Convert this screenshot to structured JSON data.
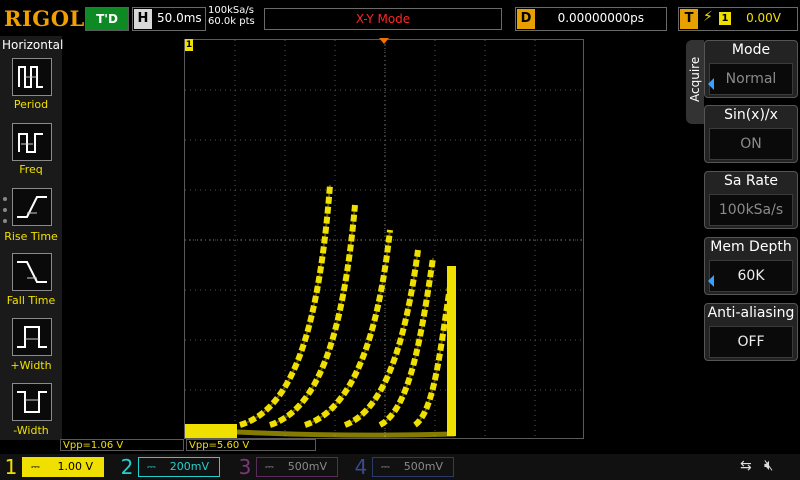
{
  "header": {
    "logo": "RIGOL",
    "run_status": "T'D",
    "horizontal_label": "H",
    "timebase": "50.0ms",
    "sample_rate": "100kSa/s",
    "memory_points": "60.0k pts",
    "mode": "X-Y Mode",
    "delay_label": "D",
    "delay_value": "0.00000000ps",
    "trigger_label": "T",
    "trigger_source": "1",
    "trigger_level": "0.00V"
  },
  "horizontal_panel": {
    "title": "Horizontal",
    "items": [
      {
        "label": "Period",
        "icon": "period-icon"
      },
      {
        "label": "Freq",
        "icon": "frequency-icon"
      },
      {
        "label": "Rise Time",
        "icon": "rise-time-icon"
      },
      {
        "label": "Fall Time",
        "icon": "fall-time-icon"
      },
      {
        "label": "+Width",
        "icon": "positive-width-icon"
      },
      {
        "label": "-Width",
        "icon": "negative-width-icon"
      }
    ]
  },
  "side_menu": {
    "tab_label": "Acquire",
    "items": [
      {
        "title": "Mode",
        "value": "Normal",
        "enabled": true,
        "has_arrow": true
      },
      {
        "title": "Sin(x)/x",
        "value": "ON",
        "enabled": false,
        "has_arrow": false
      },
      {
        "title": "Sa Rate",
        "value": "100kSa/s",
        "enabled": false,
        "has_arrow": false
      },
      {
        "title": "Mem Depth",
        "value": "60K",
        "enabled": true,
        "has_arrow": true
      },
      {
        "title": "Anti-aliasing",
        "value": "OFF",
        "enabled": true,
        "has_arrow": false
      }
    ]
  },
  "measurements": {
    "vpp_x": "Vpp=1.06 V",
    "vpp_y": "Vpp=5.60 V"
  },
  "channel_marker": "1",
  "channels": [
    {
      "number": "1",
      "scale": "1.00 V",
      "color": "#f0e000",
      "active": true
    },
    {
      "number": "2",
      "scale": "200mV",
      "color": "#22d0d0",
      "active": false
    },
    {
      "number": "3",
      "scale": "500mV",
      "color": "#c020c0",
      "active": false
    },
    {
      "number": "4",
      "scale": "500mV",
      "color": "#3060ff",
      "active": false
    }
  ],
  "colors": {
    "channel1": "#f0e000",
    "run_status_bg": "#0e8a24",
    "mode_text": "#ff2424",
    "logo": "#f2a000"
  },
  "status_icons": [
    "usb-icon",
    "speaker-mute-icon"
  ]
}
